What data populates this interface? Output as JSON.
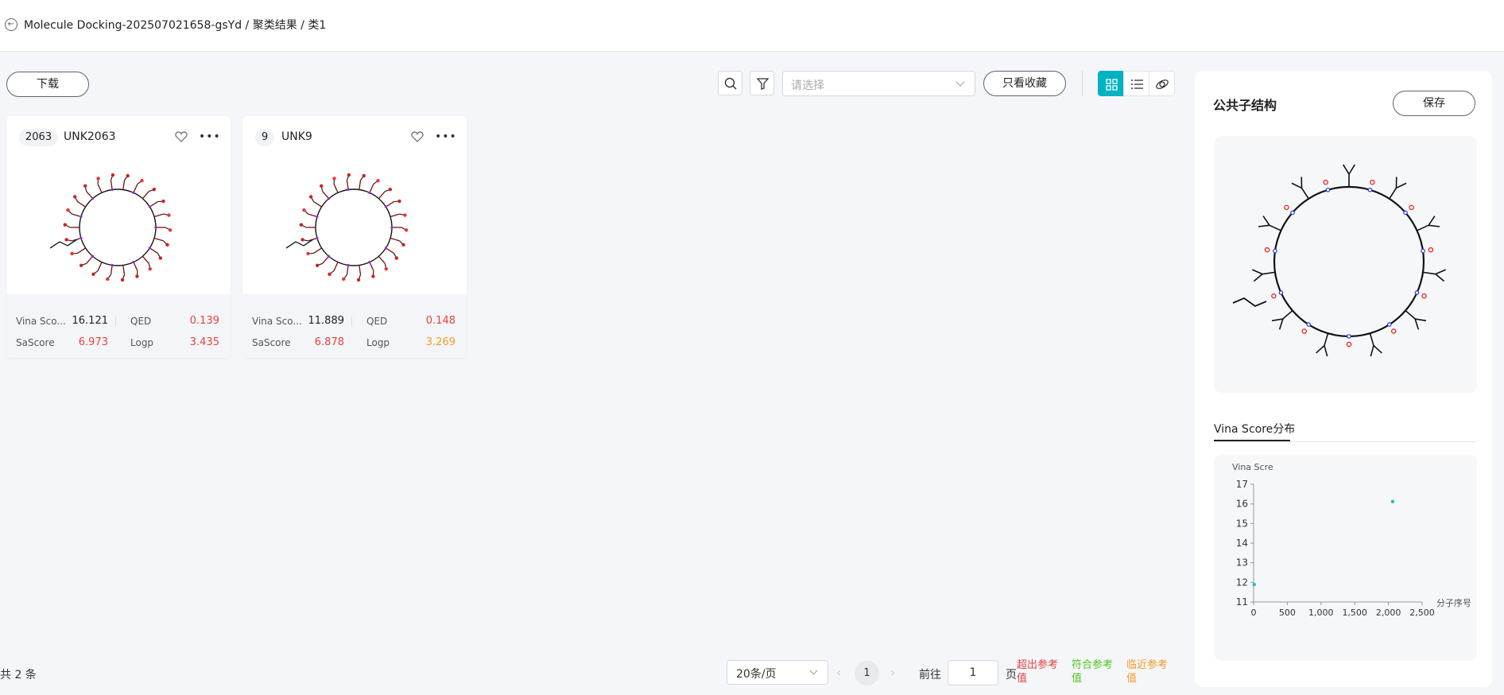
{
  "header": {
    "breadcrumb": "Molecule Docking-202507021658-gsYd / 聚类结果 / 类1"
  },
  "toolbar": {
    "download_label": "下载",
    "filter_placeholder": "请选择",
    "favorites_only_label": "只看收藏"
  },
  "cards": [
    {
      "id": "2063",
      "name": "UNK2063",
      "vina_label": "Vina Sco...",
      "vina": "16.121",
      "qed_label": "QED",
      "qed": "0.139",
      "qed_color": "#e64340",
      "sascore_label": "SaScore",
      "sascore": "6.973",
      "sascore_color": "#e64340",
      "logp_label": "Logp",
      "logp": "3.435",
      "logp_color": "#e64340"
    },
    {
      "id": "9",
      "name": "UNK9",
      "vina_label": "Vina Sco...",
      "vina": "11.889",
      "qed_label": "QED",
      "qed": "0.148",
      "qed_color": "#e64340",
      "sascore_label": "SaScore",
      "sascore": "6.878",
      "sascore_color": "#e64340",
      "logp_label": "Logp",
      "logp": "3.269",
      "logp_color": "#f59a23"
    }
  ],
  "footer": {
    "total": "共 2 条",
    "page_size": "20条/页",
    "current_page": "1",
    "goto_label": "前往",
    "goto_value": "1",
    "goto_unit": "页"
  },
  "legend": [
    {
      "label": "超出参考值",
      "color": "#e64340"
    },
    {
      "label": "符合参考值",
      "color": "#52c41a"
    },
    {
      "label": "临近参考值",
      "color": "#f59a23"
    }
  ],
  "panel": {
    "title": "公共子结构",
    "save_label": "保存",
    "tab_label": "Vina Score分布"
  },
  "chart_data": {
    "type": "scatter",
    "xlabel": "分子序号",
    "ylabel": "Vina Scre",
    "xlim": [
      0,
      2500
    ],
    "ylim": [
      11,
      17
    ],
    "x_ticks": [
      "0",
      "500",
      "1,000",
      "1,500",
      "2,000",
      "2,500"
    ],
    "y_ticks": [
      "11",
      "12",
      "13",
      "14",
      "15",
      "16",
      "17"
    ],
    "points": [
      {
        "x": 9,
        "y": 11.889
      },
      {
        "x": 2063,
        "y": 16.121
      }
    ],
    "color": "#2ab7c8"
  },
  "colors": {
    "accent": "#00b2c2",
    "danger": "#e64340"
  }
}
